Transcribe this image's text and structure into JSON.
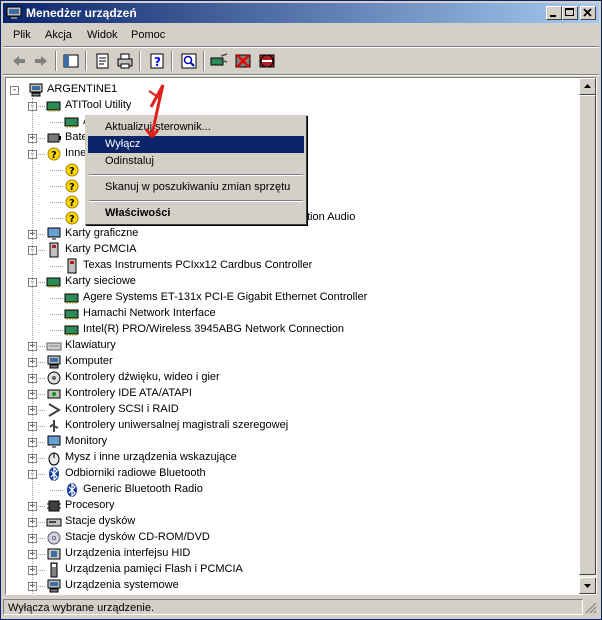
{
  "window": {
    "title": "Menedżer urządzeń"
  },
  "menu": [
    "Plik",
    "Akcja",
    "Widok",
    "Pomoc"
  ],
  "toolbar": [
    "back-icon",
    "forward-icon",
    "console-tree-icon",
    "properties-icon",
    "print-icon",
    "help-icon",
    "scan-hardware-icon",
    "update-driver-icon",
    "disable-device-icon",
    "uninstall-device-icon"
  ],
  "tree": {
    "root": "ARGENTINE1",
    "items": [
      {
        "label": "ATITool Utility"
      },
      {
        "label": "ATITool Drv"
      },
      {
        "label": "Baterie"
      },
      {
        "label": "Inne urządzenia"
      },
      {
        "label": "Karty graficzne"
      },
      {
        "label": "Karty PCMCIA"
      },
      {
        "label": "Texas Instruments PCIxx12 Cardbus Controller"
      },
      {
        "label": "Karty sieciowe"
      },
      {
        "label": "Agere Systems ET-131x PCI-E Gigabit Ethernet Controller"
      },
      {
        "label": "Hamachi Network Interface"
      },
      {
        "label": "Intel(R) PRO/Wireless 3945ABG Network Connection"
      },
      {
        "label": "Klawiatury"
      },
      {
        "label": "Komputer"
      },
      {
        "label": "Kontrolery dźwięku, wideo i gier"
      },
      {
        "label": "Kontrolery IDE ATA/ATAPI"
      },
      {
        "label": "Kontrolery SCSI i RAID"
      },
      {
        "label": "Kontrolery uniwersalnej magistrali szeregowej"
      },
      {
        "label": "Monitory"
      },
      {
        "label": "Mysz i inne urządzenia wskazujące"
      },
      {
        "label": "Odbiorniki radiowe Bluetooth"
      },
      {
        "label": "Generic Bluetooth Radio"
      },
      {
        "label": "Procesory"
      },
      {
        "label": "Stacje dysków"
      },
      {
        "label": "Stacje dysków CD-ROM/DVD"
      },
      {
        "label": "Urządzenia interfejsu HID"
      },
      {
        "label": "Urządzenia pamięci Flash i PCMCIA"
      },
      {
        "label": "Urządzenia systemowe"
      },
      {
        "label": "Woluminy"
      }
    ],
    "hidden_suffix": "inition Audio"
  },
  "context_menu": {
    "items": [
      "Aktualizuj sterownik...",
      "Wyłącz",
      "Odinstaluj",
      "Skanuj w poszukiwaniu zmian sprzętu",
      "Właściwości"
    ],
    "highlighted": "Wyłącz"
  },
  "status": {
    "text": "Wyłącza wybrane urządzenie."
  },
  "colors": {
    "titlebar": "#0a246a",
    "highlight": "#0a246a",
    "arrow": "#e0201c"
  }
}
